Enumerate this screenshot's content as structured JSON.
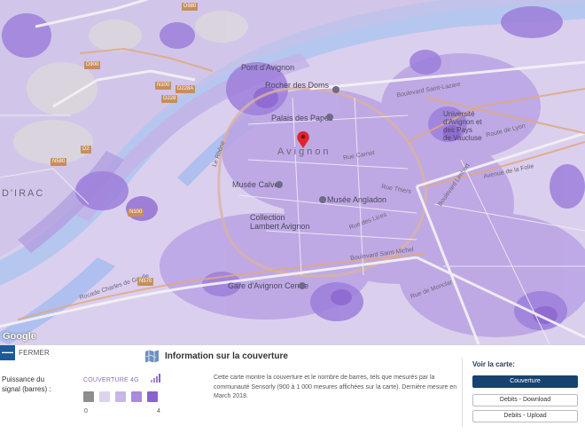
{
  "map": {
    "city_name": "Avignon",
    "attribution": "Google",
    "labels": {
      "pont": "Pont d'Avignon",
      "rocher": "Rocher des Doms",
      "palais": "Palais des Papes",
      "calvet": "Musée Calvet",
      "angladon": "Musée Angladon",
      "collection": "Collection\nLambert Avignon",
      "gare": "Gare d'Avignon Centre",
      "universite": "Université\nd'Avignon et\ndes Pays\nde Vaucluse",
      "irac": "D'IRAC",
      "bd_saint_lazare": "Boulevard Saint-Lazare",
      "bd_saint_michel": "Boulevard Saint-Michel",
      "route_lyon": "Route de Lyon",
      "bd_limbert": "Boulevard Limbert",
      "rue_carnot": "Rue Carnot",
      "rue_thiers": "Rue Thiers",
      "rue_lices": "Rue des Lices",
      "rocade": "Rocade Charles de Gaulle",
      "le_rhone": "Le Rhône",
      "av_folie": "Avenue de la Folie",
      "rue_monclar": "Rue de Monclar"
    },
    "road_tags": [
      "D2",
      "N100",
      "N580",
      "D228A",
      "D228",
      "D900",
      "N100",
      "N570",
      "D980"
    ]
  },
  "panel": {
    "close_label": "FERMER",
    "close_symbol": "—",
    "info_title": "Information sur la couverture",
    "signal_label": "Puissance du signal (barres) :",
    "legend_title": "COUVERTURE 4G",
    "legend_min": "0",
    "legend_max": "4",
    "legend_levels": [
      0,
      1,
      2,
      3,
      4
    ],
    "legend_colors": [
      "#8e8e8e",
      "#ddd3ee",
      "#c8b6e6",
      "#a98bdc",
      "#8a63cf"
    ],
    "description": "Cette carte montre la couverture et le nombre de barres, tels que mesurés par la communauté Sensorly (900 à 1 000 mesures affichées sur la carte). Dernière mesure en March 2018.",
    "voir_title": "Voir la carte:",
    "btn_couverture": "Couverture",
    "btn_download": "Debits - Download",
    "btn_upload": "Debits - Upload"
  },
  "colors": {
    "accent_blue": "#18426f",
    "close_blue": "#1b5a9b",
    "coverage_purple": "#8a63cf",
    "river": "#a9c4f0",
    "marker_red": "#e0262a"
  }
}
